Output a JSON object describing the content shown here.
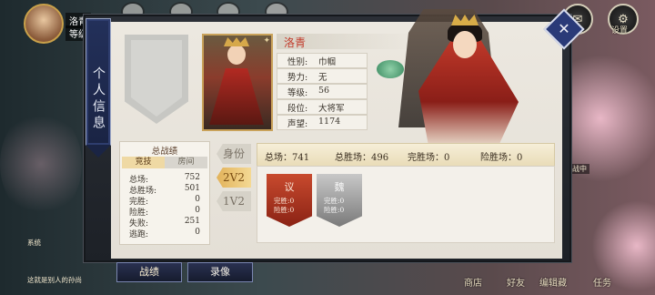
{
  "player": {
    "name": "洛青",
    "level_prefix": "等级"
  },
  "top_right": {
    "mail_icon": "mail-icon",
    "settings_label": "设置"
  },
  "panel": {
    "side_tab": "个人信息",
    "hero_name": "洛青",
    "attributes": [
      {
        "key": "性别:",
        "value": "巾帼"
      },
      {
        "key": "势力:",
        "value": "无"
      },
      {
        "key": "等级:",
        "value": "56"
      },
      {
        "key": "段位:",
        "value": "大将军"
      },
      {
        "key": "声望:",
        "value": "1174"
      }
    ],
    "stats": {
      "title": "总战绩",
      "tabs": [
        "竞技",
        "房间"
      ],
      "active_tab": "竞技",
      "rows": [
        {
          "key": "总场:",
          "value": "752"
        },
        {
          "key": "总胜场:",
          "value": "501"
        },
        {
          "key": "完胜:",
          "value": "0"
        },
        {
          "key": "险胜:",
          "value": "0"
        },
        {
          "key": "失败:",
          "value": "251"
        },
        {
          "key": "逃跑:",
          "value": "0"
        }
      ]
    },
    "modes": [
      "身份",
      "2V2",
      "1V2"
    ],
    "active_mode": "2V2",
    "mode_stats": {
      "total": "总场：741",
      "wins": "总胜场：496",
      "perfect": "完胜场：0",
      "close": "险胜场：0"
    },
    "badges": [
      {
        "title": "议",
        "line1": "完胜:0",
        "line2": "险胜:0",
        "color": "#b83a22"
      },
      {
        "title": "魏",
        "line1": "完胜:0",
        "line2": "险胜:0",
        "color": "#9a9a9a"
      }
    ]
  },
  "bottom": {
    "buttons": [
      "战绩",
      "录像"
    ],
    "active_button": "战绩",
    "nav": [
      "商店",
      "好友",
      "编辑藏",
      "任务"
    ],
    "chat_line1": "系统",
    "chat_line2": "这就是别人的孙尚",
    "side_hint": "战中"
  },
  "colors": {
    "accent_gold": "#e2b25a",
    "panel_navy": "#23305a",
    "hero_red": "#c23a2a"
  }
}
